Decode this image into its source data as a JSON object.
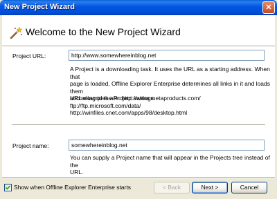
{
  "window": {
    "title": "New Project Wizard"
  },
  "header": {
    "title": "Welcome to the New Project Wizard"
  },
  "url_section": {
    "label": "Project URL:",
    "value": "http://www.somewhereinblog.net",
    "description_line1": "A Project is a downloading task. It uses the URL as a starting address. When that",
    "description_line2": "page is loaded, Offline Explorer Enterprise determines all links in it and loads them",
    "description_line3": "according to the Project settings.",
    "examples_line1": "URL examples are: http://www.metaproducts.com/ ftp://ftp.microsoft.com/data/",
    "examples_line2": "http://winfiles.cnet.com/apps/98/desktop.html"
  },
  "name_section": {
    "label": "Project name:",
    "value": "somewhereinblog.net",
    "description_line1": "You can supply a Project name that will appear in the Projects tree instead of the",
    "description_line2": "URL."
  },
  "footer": {
    "checkbox_label": "Show when Offline Explorer Enterprise starts",
    "checkbox_checked": true,
    "back_label": "< Back",
    "next_label": "Next >",
    "cancel_label": "Cancel"
  }
}
